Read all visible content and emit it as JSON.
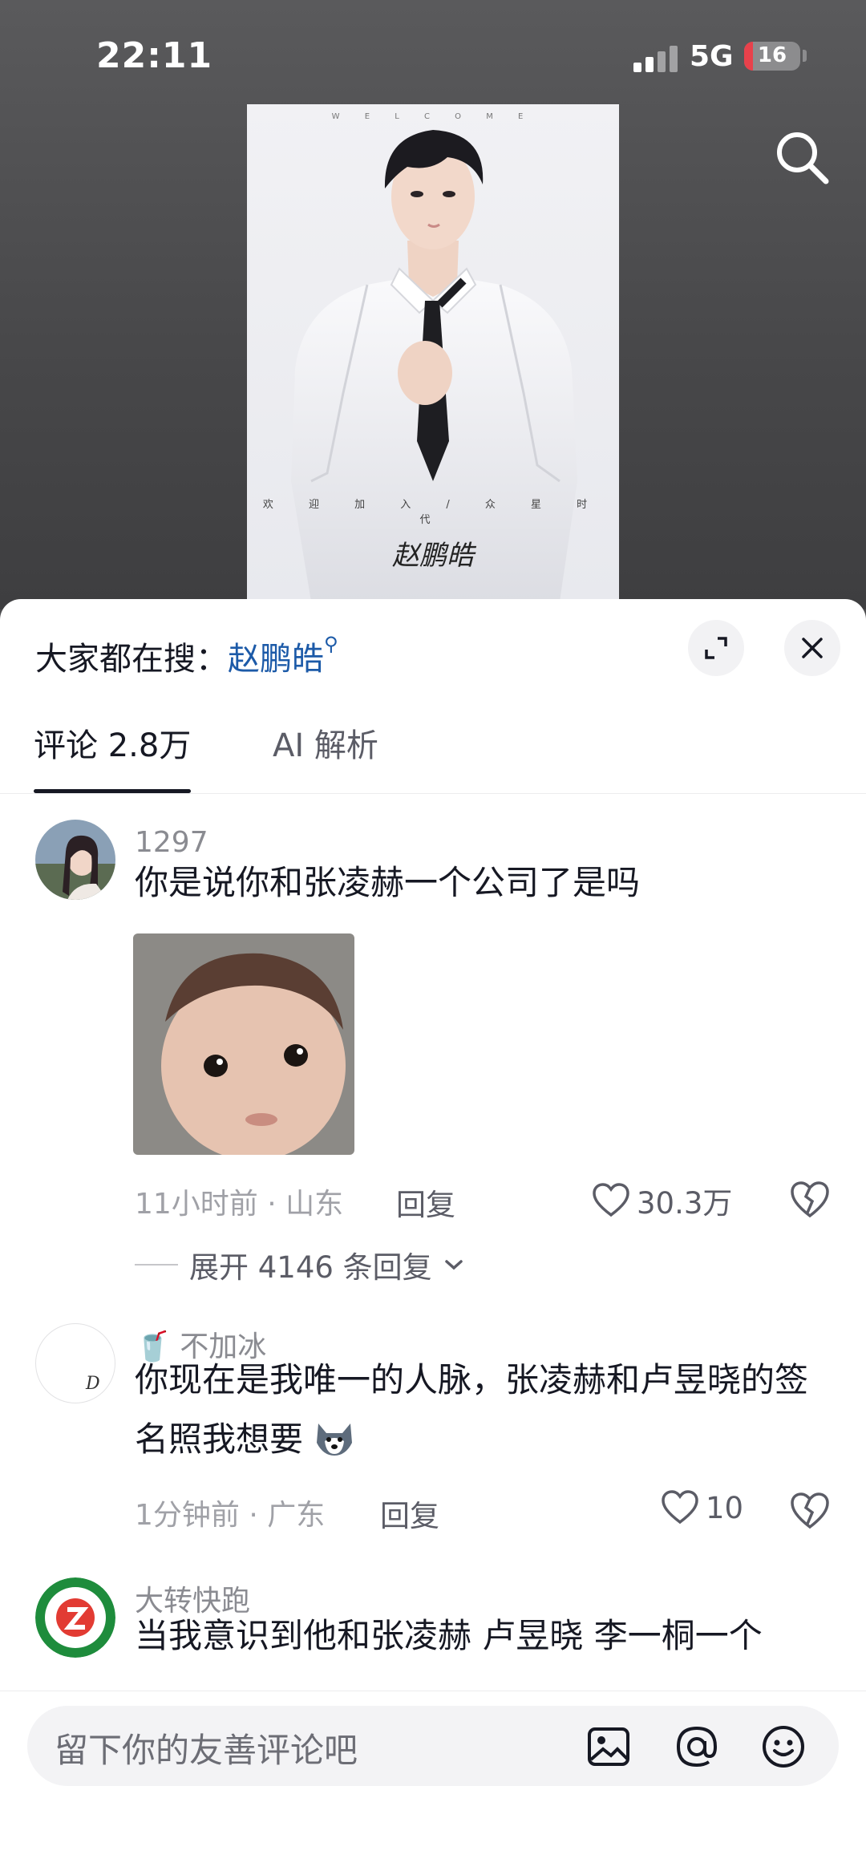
{
  "status_bar": {
    "time": "22:11",
    "network": "5G",
    "battery": "16",
    "battery_level": 0.16
  },
  "poster": {
    "top_text": "W E L C O M E",
    "tagline": "欢 迎 加 入 / 众 星 时 代",
    "name": "赵鹏皓"
  },
  "panel": {
    "hot_search_label": "大家都在搜：",
    "hot_search_keyword": "赵鹏皓",
    "expand_icon": "expand-icon",
    "close_icon": "close-icon"
  },
  "tabs": [
    {
      "label": "评论 2.8万"
    },
    {
      "label": "AI 解析"
    }
  ],
  "comments": [
    {
      "username": "1297",
      "text": "你是说你和张凌赫一个公司了是吗",
      "time_location": "11小时前 · 山东",
      "reply_label": "回复",
      "likes": "30.3万",
      "expand_label": "展开 4146 条回复",
      "has_image": true
    },
    {
      "username": "不加冰",
      "username_emoji": "🥤",
      "text": "你现在是我唯一的人脉，张凌赫和卢昱晓的签名照我想要",
      "time_location": "1分钟前 · 广东",
      "reply_label": "回复",
      "likes": "10"
    },
    {
      "username": "大转快跑",
      "text": "当我意识到他和张凌赫 卢昱晓 李一桐一个"
    }
  ],
  "input_bar": {
    "placeholder": "留下你的友善评论吧",
    "icons": [
      "image-icon",
      "at-icon",
      "emoji-icon"
    ]
  },
  "colors": {
    "accent_link": "#1c5aa8",
    "battery_low": "#e8414b"
  }
}
